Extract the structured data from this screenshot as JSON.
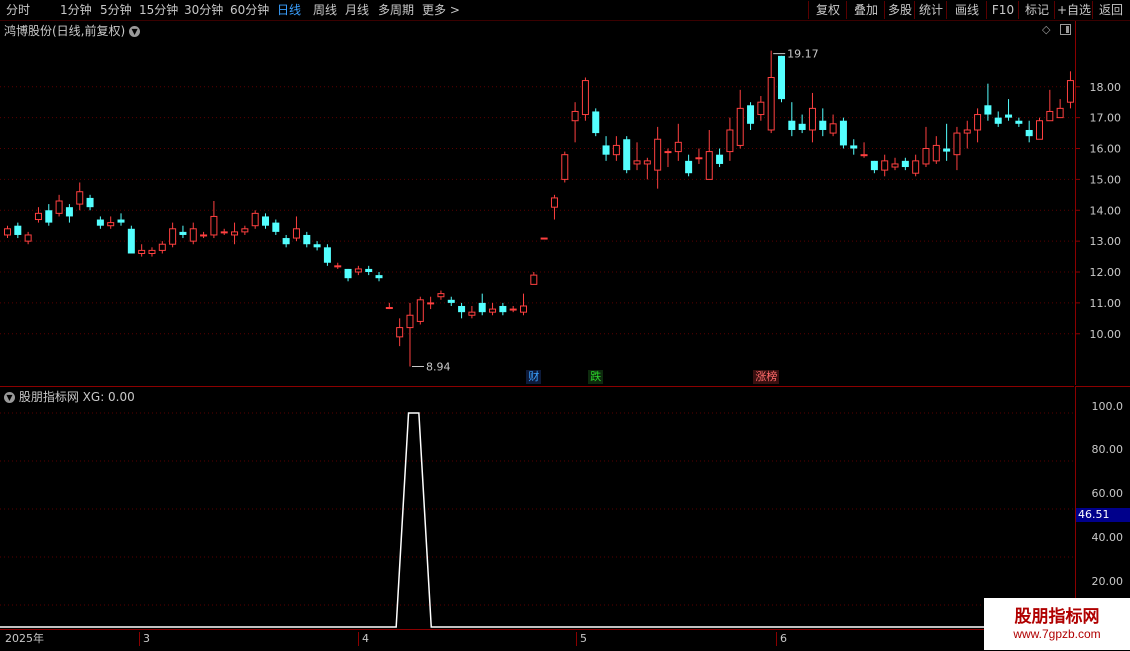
{
  "toolbar": {
    "periods": [
      "分时",
      "1分钟",
      "5分钟",
      "15分钟",
      "30分钟",
      "60分钟",
      "日线",
      "周线",
      "月线",
      "多周期",
      "更多 >"
    ],
    "active_period": "日线",
    "buttons": [
      "复权",
      "叠加",
      "多股",
      "统计",
      "画线",
      "F10",
      "标记",
      "+自选",
      "返回"
    ]
  },
  "main_chart": {
    "title": "鸿博股份(日线,前复权)",
    "high_label": "19.17",
    "low_label": "8.94",
    "events": [
      {
        "text": "财",
        "color": "#3aa0ff",
        "bg": "#0d1a3a"
      },
      {
        "text": "跌",
        "color": "#2bd52b",
        "bg": "#0d2a0d"
      },
      {
        "text": "涨榜",
        "color": "#ff6a6a",
        "bg": "#3a1010"
      }
    ]
  },
  "sub_chart": {
    "title": "股朋指标网",
    "indicator": "XG: 0.00",
    "current_value": "46.51",
    "y_ticks": [
      "100.0",
      "80.00",
      "60.00",
      "40.00",
      "20.00"
    ]
  },
  "date_axis": [
    "2025年",
    "3",
    "4",
    "5",
    "6"
  ],
  "watermark": {
    "line1": "股朋指标网",
    "line2": "www.7gpzb.com"
  },
  "colors": {
    "up": "#ff4040",
    "down": "#54ffff",
    "background": "#000000",
    "grid": "#8b0000",
    "active": "#3aa0ff"
  },
  "chart_data": {
    "type": "candlestick",
    "ylim": [
      8.6,
      20.0
    ],
    "y_ticks": [
      10.0,
      11.0,
      12.0,
      13.0,
      14.0,
      15.0,
      16.0,
      17.0,
      18.0
    ],
    "candles": [
      [
        13.2,
        13.4,
        13.5,
        13.1
      ],
      [
        13.5,
        13.2,
        13.6,
        13.1
      ],
      [
        13.0,
        13.2,
        13.3,
        12.9
      ],
      [
        13.7,
        13.9,
        14.1,
        13.6
      ],
      [
        14.0,
        13.6,
        14.2,
        13.5
      ],
      [
        13.9,
        14.3,
        14.5,
        13.8
      ],
      [
        14.1,
        13.8,
        14.2,
        13.6
      ],
      [
        14.2,
        14.6,
        14.9,
        14.0
      ],
      [
        14.4,
        14.1,
        14.5,
        14.0
      ],
      [
        13.7,
        13.5,
        13.8,
        13.4
      ],
      [
        13.5,
        13.6,
        13.8,
        13.4
      ],
      [
        13.7,
        13.6,
        13.9,
        13.5
      ],
      [
        13.4,
        12.6,
        13.5,
        12.6
      ],
      [
        12.6,
        12.7,
        12.9,
        12.5
      ],
      [
        12.6,
        12.7,
        12.8,
        12.5
      ],
      [
        12.7,
        12.9,
        13.0,
        12.6
      ],
      [
        12.9,
        13.4,
        13.6,
        12.8
      ],
      [
        13.3,
        13.2,
        13.5,
        13.1
      ],
      [
        13.0,
        13.4,
        13.6,
        12.9
      ],
      [
        13.2,
        13.2,
        13.3,
        13.1
      ],
      [
        13.2,
        13.8,
        14.3,
        13.1
      ],
      [
        13.3,
        13.3,
        13.4,
        13.2
      ],
      [
        13.2,
        13.3,
        13.6,
        12.9
      ],
      [
        13.3,
        13.4,
        13.5,
        13.2
      ],
      [
        13.5,
        13.9,
        14.0,
        13.4
      ],
      [
        13.8,
        13.5,
        13.9,
        13.4
      ],
      [
        13.6,
        13.3,
        13.7,
        13.2
      ],
      [
        13.1,
        12.9,
        13.2,
        12.8
      ],
      [
        13.1,
        13.4,
        13.8,
        13.0
      ],
      [
        13.2,
        12.9,
        13.3,
        12.8
      ],
      [
        12.9,
        12.8,
        13.0,
        12.7
      ],
      [
        12.8,
        12.3,
        12.9,
        12.2
      ],
      [
        12.2,
        12.2,
        12.3,
        12.1
      ],
      [
        12.1,
        11.8,
        12.1,
        11.7
      ],
      [
        12.0,
        12.1,
        12.2,
        11.9
      ],
      [
        12.1,
        12.0,
        12.2,
        11.9
      ],
      [
        11.9,
        11.8,
        12.0,
        11.7
      ],
      [
        10.85,
        10.85,
        11.0,
        10.8
      ],
      [
        9.9,
        10.2,
        10.5,
        9.6
      ],
      [
        10.2,
        10.6,
        11.0,
        8.94
      ],
      [
        10.4,
        11.1,
        11.2,
        10.3
      ],
      [
        11.0,
        11.0,
        11.2,
        10.8
      ],
      [
        11.2,
        11.3,
        11.4,
        11.1
      ],
      [
        11.1,
        11.0,
        11.2,
        10.9
      ],
      [
        10.9,
        10.7,
        11.0,
        10.5
      ],
      [
        10.6,
        10.7,
        10.9,
        10.5
      ],
      [
        11.0,
        10.7,
        11.3,
        10.6
      ],
      [
        10.7,
        10.8,
        11.0,
        10.6
      ],
      [
        10.9,
        10.7,
        11.0,
        10.6
      ],
      [
        10.8,
        10.8,
        10.9,
        10.7
      ],
      [
        10.7,
        10.9,
        11.3,
        10.6
      ],
      [
        11.6,
        11.9,
        12.0,
        11.6
      ],
      [
        13.1,
        13.1,
        13.1,
        13.1
      ],
      [
        14.1,
        14.4,
        14.5,
        13.7
      ],
      [
        15.0,
        15.8,
        15.9,
        14.9
      ],
      [
        16.9,
        17.2,
        17.5,
        16.2
      ],
      [
        17.1,
        18.2,
        18.3,
        16.9
      ],
      [
        17.2,
        16.5,
        17.3,
        16.4
      ],
      [
        16.1,
        15.8,
        16.4,
        15.6
      ],
      [
        15.8,
        16.1,
        16.4,
        15.6
      ],
      [
        16.3,
        15.3,
        16.4,
        15.2
      ],
      [
        15.5,
        15.6,
        16.2,
        15.3
      ],
      [
        15.5,
        15.6,
        15.7,
        15.0
      ],
      [
        15.3,
        16.3,
        16.7,
        14.7
      ],
      [
        15.9,
        15.9,
        16.0,
        15.4
      ],
      [
        15.9,
        16.2,
        16.8,
        15.6
      ],
      [
        15.6,
        15.2,
        15.8,
        15.1
      ],
      [
        15.7,
        15.7,
        16.0,
        15.5
      ],
      [
        15.0,
        15.9,
        16.6,
        15.0
      ],
      [
        15.8,
        15.5,
        16.0,
        15.4
      ],
      [
        15.9,
        16.6,
        17.0,
        15.6
      ],
      [
        16.1,
        17.3,
        17.9,
        16.0
      ],
      [
        17.4,
        16.8,
        17.5,
        16.6
      ],
      [
        17.1,
        17.5,
        17.7,
        16.9
      ],
      [
        16.6,
        18.3,
        19.17,
        16.5
      ],
      [
        19.0,
        17.6,
        19.0,
        17.5
      ],
      [
        16.9,
        16.6,
        17.5,
        16.4
      ],
      [
        16.8,
        16.6,
        17.1,
        16.5
      ],
      [
        16.6,
        17.3,
        17.8,
        16.2
      ],
      [
        16.9,
        16.6,
        17.3,
        16.4
      ],
      [
        16.5,
        16.8,
        17.1,
        16.4
      ],
      [
        16.9,
        16.1,
        17.0,
        16.0
      ],
      [
        16.1,
        16.0,
        16.3,
        15.8
      ],
      [
        15.8,
        15.8,
        16.2,
        15.7
      ],
      [
        15.6,
        15.3,
        15.6,
        15.2
      ],
      [
        15.3,
        15.6,
        15.8,
        15.1
      ],
      [
        15.4,
        15.5,
        15.7,
        15.3
      ],
      [
        15.6,
        15.4,
        15.7,
        15.3
      ],
      [
        15.2,
        15.6,
        15.8,
        15.1
      ],
      [
        15.5,
        16.0,
        16.7,
        15.4
      ],
      [
        15.6,
        16.1,
        16.4,
        15.5
      ],
      [
        16.0,
        15.9,
        16.8,
        15.6
      ],
      [
        15.8,
        16.5,
        16.7,
        15.3
      ],
      [
        16.5,
        16.6,
        16.9,
        16.0
      ],
      [
        16.6,
        17.1,
        17.3,
        16.2
      ],
      [
        17.4,
        17.1,
        18.1,
        16.9
      ],
      [
        17.0,
        16.8,
        17.2,
        16.7
      ],
      [
        17.1,
        17.0,
        17.6,
        16.9
      ],
      [
        16.9,
        16.8,
        17.0,
        16.7
      ],
      [
        16.6,
        16.4,
        16.9,
        16.2
      ],
      [
        16.3,
        16.9,
        17.0,
        16.3
      ],
      [
        16.9,
        17.2,
        17.9,
        16.9
      ],
      [
        17.0,
        17.3,
        17.6,
        17.1
      ],
      [
        17.5,
        18.2,
        18.5,
        17.3
      ]
    ],
    "indicator": {
      "name": "XG",
      "ylim": [
        10,
        110
      ],
      "values_note": "single pulse at 100 around candle 39-41, otherwise 0"
    }
  }
}
